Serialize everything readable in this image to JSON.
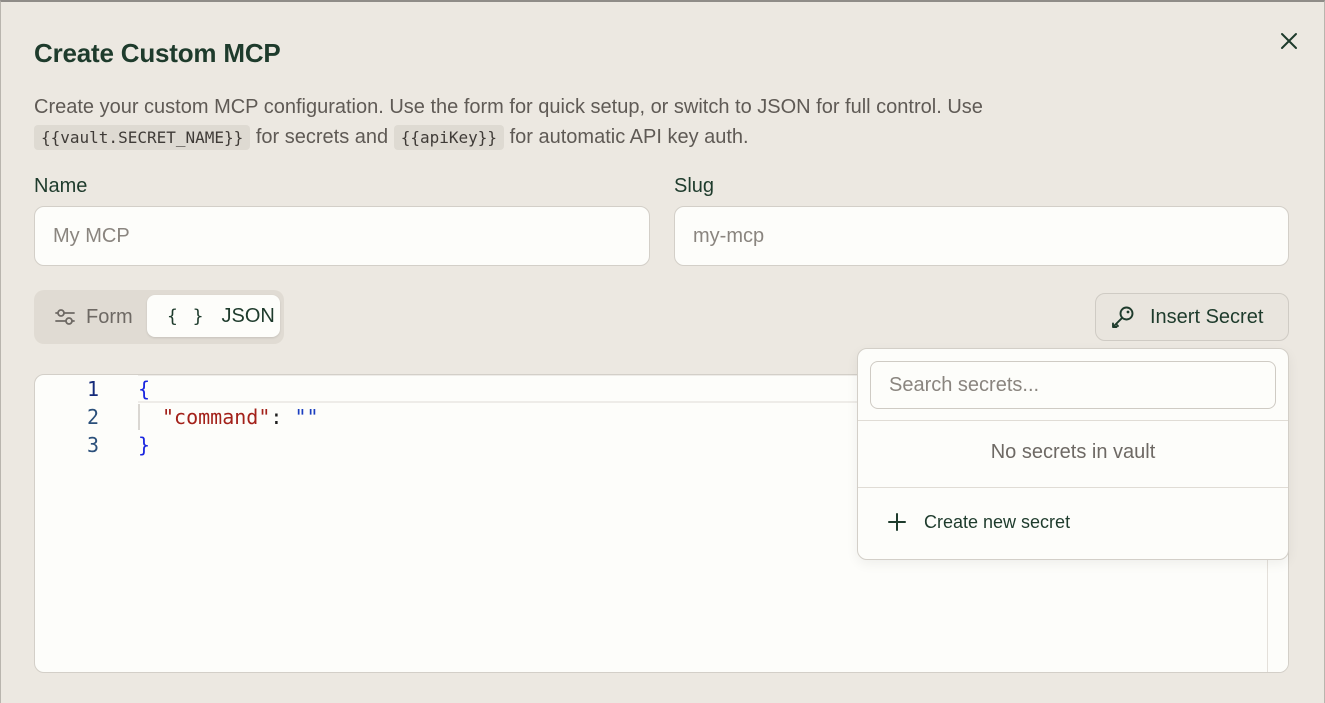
{
  "dialog": {
    "title": "Create Custom MCP",
    "description_part1": "Create your custom MCP configuration. Use the form for quick setup, or switch to JSON for full control. Use ",
    "vault_token": "{{vault.SECRET_NAME}}",
    "description_part2": " for secrets and ",
    "apikey_token": "{{apiKey}}",
    "description_part3": " for automatic API key auth."
  },
  "fields": {
    "name_label": "Name",
    "name_placeholder": "My MCP",
    "slug_label": "Slug",
    "slug_placeholder": "my-mcp"
  },
  "mode_toggle": {
    "form_label": "Form",
    "json_label": "JSON",
    "json_icon_text": "{ }",
    "selected": "JSON"
  },
  "insert_secret": {
    "label": "Insert Secret"
  },
  "editor": {
    "lines": [
      {
        "number": "1",
        "brace_open": "{"
      },
      {
        "number": "2",
        "key": "\"command\"",
        "colon": ": ",
        "value": "\"\""
      },
      {
        "number": "3",
        "brace_close": "}"
      }
    ]
  },
  "secrets_dropdown": {
    "search_placeholder": "Search secrets...",
    "empty_message": "No secrets in vault",
    "create_label": "Create new secret"
  },
  "icons": {
    "close": "close-icon",
    "form": "sliders-icon",
    "key": "key-icon",
    "plus": "plus-icon"
  }
}
